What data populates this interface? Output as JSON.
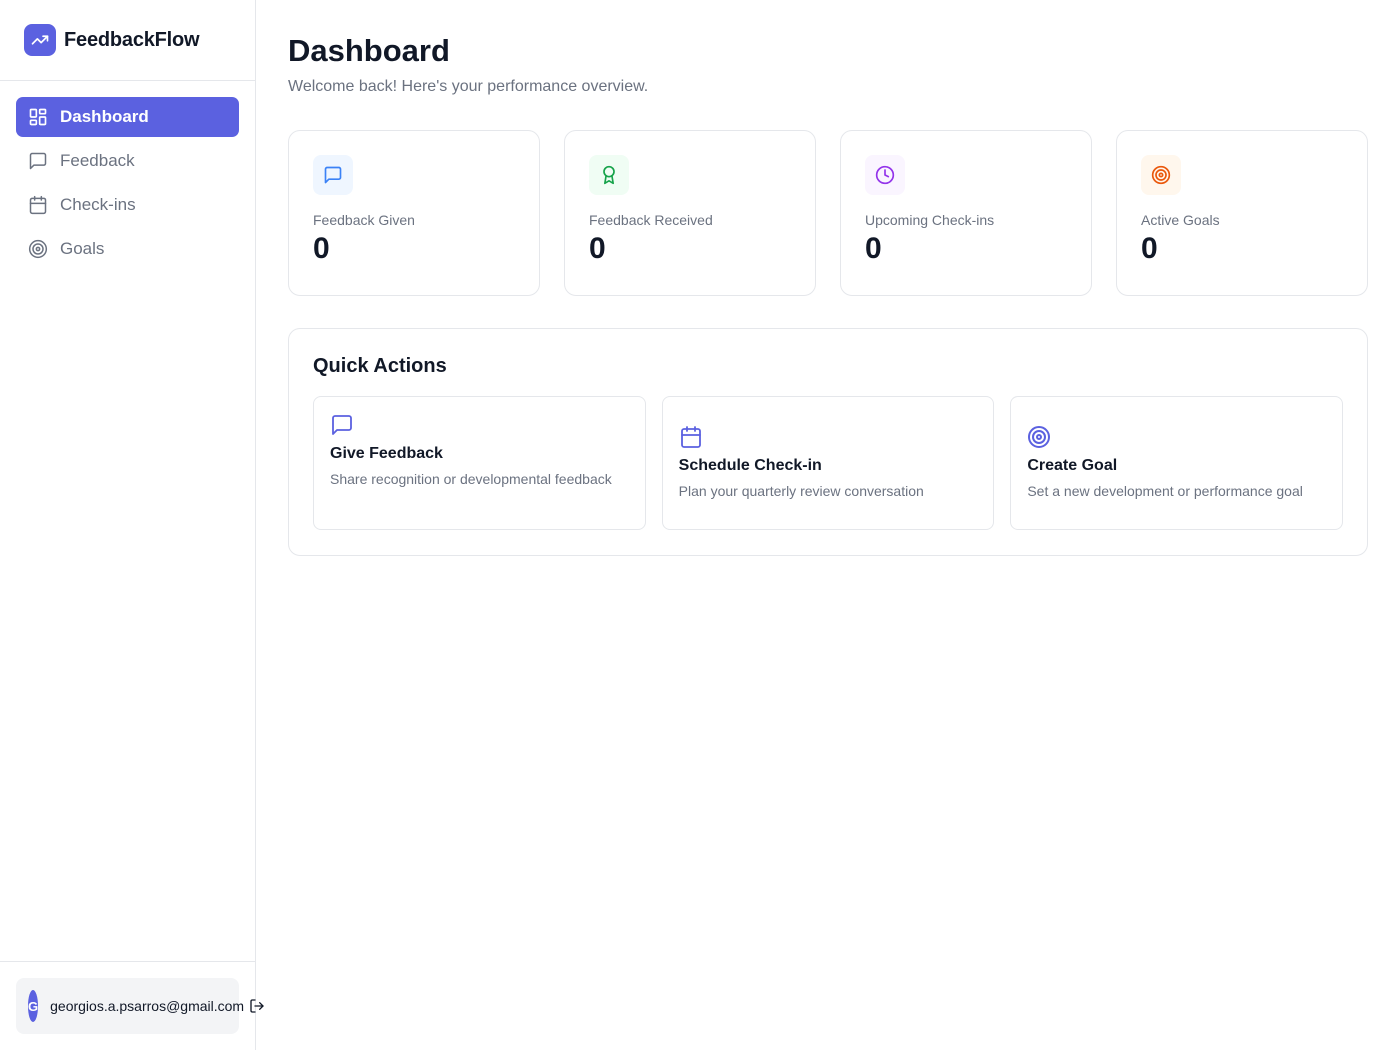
{
  "brand": {
    "name": "FeedbackFlow",
    "icon": "trending-up-icon",
    "color": "#5b61e0"
  },
  "sidebar": {
    "items": [
      {
        "label": "Dashboard",
        "icon": "layout-dashboard-icon",
        "active": true
      },
      {
        "label": "Feedback",
        "icon": "message-square-icon",
        "active": false
      },
      {
        "label": "Check-ins",
        "icon": "calendar-icon",
        "active": false
      },
      {
        "label": "Goals",
        "icon": "target-icon",
        "active": false
      }
    ]
  },
  "user": {
    "initial": "G",
    "email": "georgios.a.psarros@gmail.com",
    "logout_icon": "log-out-icon"
  },
  "header": {
    "title": "Dashboard",
    "subtitle": "Welcome back! Here's your performance overview."
  },
  "stats": [
    {
      "label": "Feedback Given",
      "value": "0",
      "icon": "message-square-icon",
      "color": "#3b82f6",
      "bg": "#eff6ff"
    },
    {
      "label": "Feedback Received",
      "value": "0",
      "icon": "award-icon",
      "color": "#16a34a",
      "bg": "#f0fdf4"
    },
    {
      "label": "Upcoming Check-ins",
      "value": "0",
      "icon": "clock-icon",
      "color": "#9333ea",
      "bg": "#faf5ff"
    },
    {
      "label": "Active Goals",
      "value": "0",
      "icon": "target-icon",
      "color": "#ea580c",
      "bg": "#fff7ed"
    }
  ],
  "quick_actions": {
    "title": "Quick Actions",
    "items": [
      {
        "title": "Give Feedback",
        "description": "Share recognition or developmental feedback",
        "icon": "message-square-icon"
      },
      {
        "title": "Schedule Check-in",
        "description": "Plan your quarterly review conversation",
        "icon": "calendar-icon"
      },
      {
        "title": "Create Goal",
        "description": "Set a new development or performance goal",
        "icon": "target-icon"
      }
    ]
  }
}
